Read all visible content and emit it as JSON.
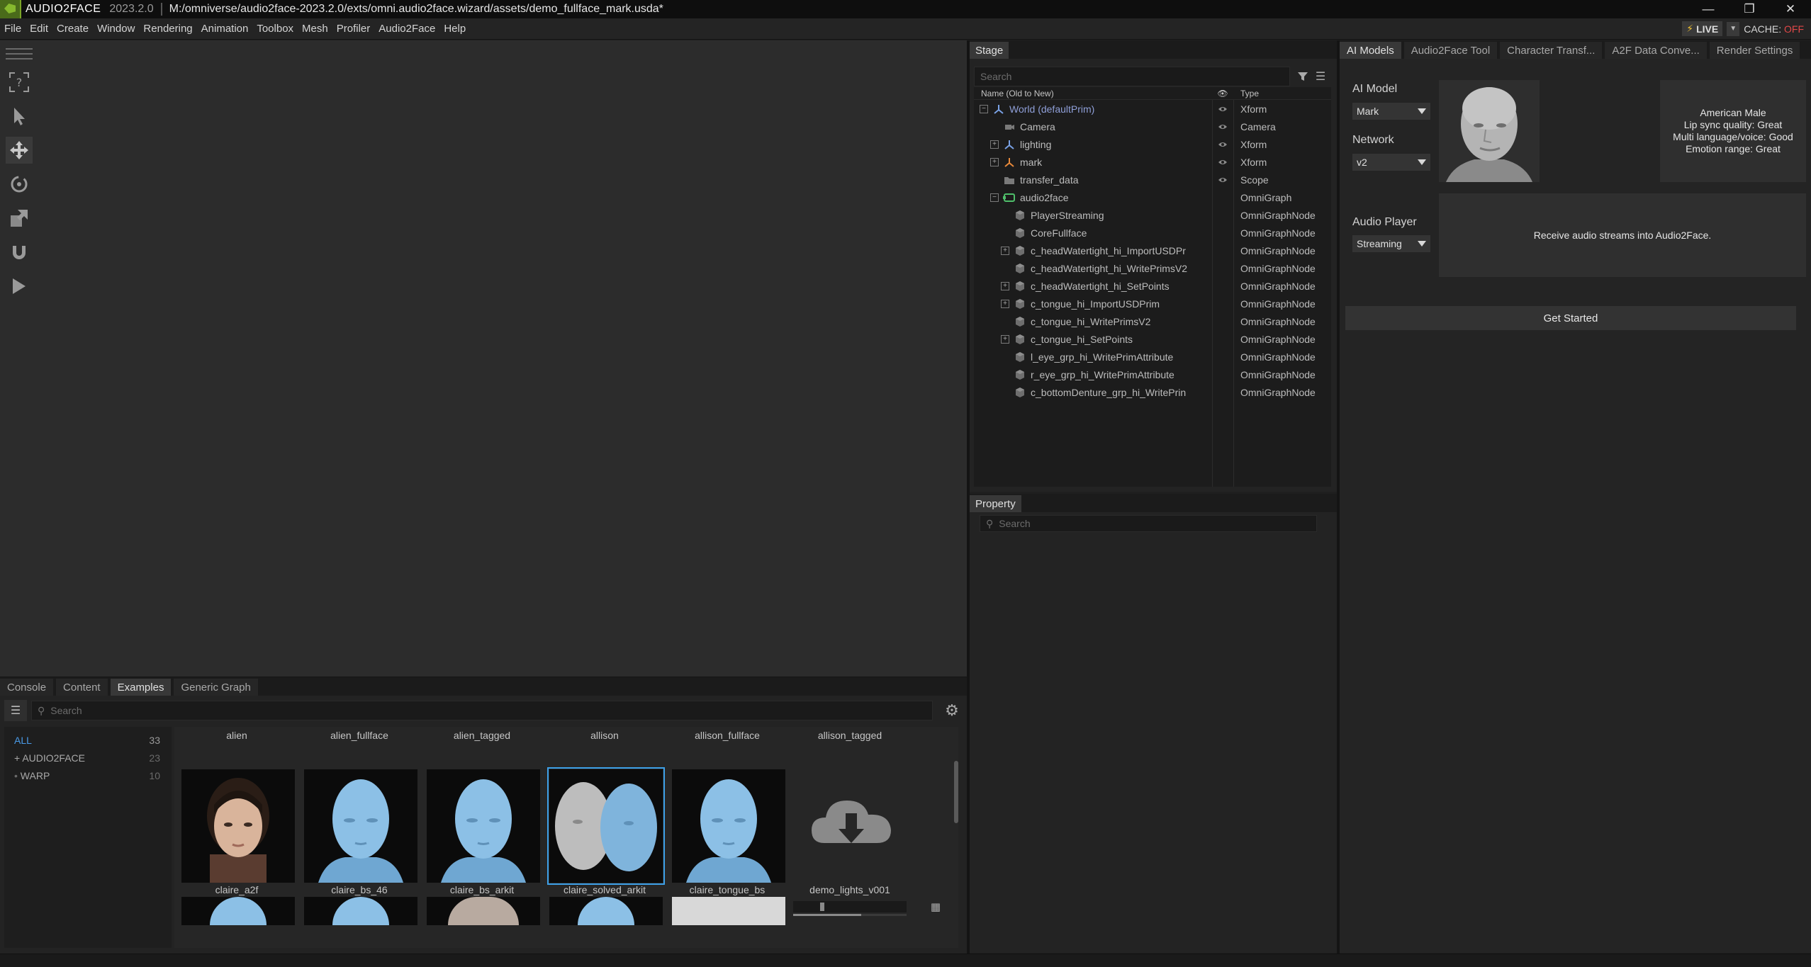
{
  "titlebar": {
    "app_name": "AUDIO2FACE",
    "version": "2023.2.0",
    "path": "M:/omniverse/audio2face-2023.2.0/exts/omni.audio2face.wizard/assets/demo_fullface_mark.usda*",
    "controls": [
      "minimize",
      "restore",
      "close"
    ]
  },
  "menubar": {
    "items": [
      "File",
      "Edit",
      "Create",
      "Window",
      "Rendering",
      "Animation",
      "Toolbox",
      "Mesh",
      "Profiler",
      "Audio2Face",
      "Help"
    ],
    "live_label": "LIVE",
    "cache_label": "CACHE:",
    "cache_state": "OFF"
  },
  "toolbar": {
    "tools": [
      "help-select-icon",
      "select-arrow-icon",
      "move-icon",
      "rotate-icon",
      "scale-icon",
      "snap-magnet-icon",
      "play-icon"
    ]
  },
  "bottom": {
    "tabs": [
      "Console",
      "Content",
      "Examples",
      "Generic Graph"
    ],
    "active_tab": "Examples",
    "search_placeholder": "Search",
    "tree": [
      {
        "label": "ALL",
        "count": "33"
      },
      {
        "label": "AUDIO2FACE",
        "count": "23",
        "prefix": "+"
      },
      {
        "label": "WARP",
        "count": "10",
        "prefix": "•"
      }
    ],
    "top_labels": [
      "alien",
      "alien_fullface",
      "alien_tagged",
      "allison",
      "allison_fullface",
      "allison_tagged"
    ],
    "items": [
      {
        "label": "claire_a2f"
      },
      {
        "label": "claire_bs_46"
      },
      {
        "label": "claire_bs_arkit"
      },
      {
        "label": "claire_solved_arkit"
      },
      {
        "label": "claire_tongue_bs"
      },
      {
        "label": "demo_lights_v001"
      }
    ]
  },
  "stage": {
    "tab": "Stage",
    "search_placeholder": "Search",
    "header_name": "Name (Old to New)",
    "header_type": "Type",
    "rows": [
      {
        "name": "World (defaultPrim)",
        "type": "Xform",
        "indent": 0,
        "exp": "-",
        "icon": "xform",
        "vis": true
      },
      {
        "name": "Camera",
        "type": "Camera",
        "indent": 1,
        "exp": "",
        "icon": "camera",
        "vis": true
      },
      {
        "name": "lighting",
        "type": "Xform",
        "indent": 1,
        "exp": "+",
        "icon": "xform",
        "vis": true
      },
      {
        "name": "mark",
        "type": "Xform",
        "indent": 1,
        "exp": "+",
        "icon": "xform-orange",
        "vis": true
      },
      {
        "name": "transfer_data",
        "type": "Scope",
        "indent": 1,
        "exp": "",
        "icon": "folder",
        "vis": true
      },
      {
        "name": "audio2face",
        "type": "OmniGraph",
        "indent": 1,
        "exp": "-",
        "icon": "graph",
        "vis": false
      },
      {
        "name": "PlayerStreaming",
        "type": "OmniGraphNode",
        "indent": 2,
        "exp": "",
        "icon": "cube",
        "vis": false
      },
      {
        "name": "CoreFullface",
        "type": "OmniGraphNode",
        "indent": 2,
        "exp": "",
        "icon": "cube",
        "vis": false
      },
      {
        "name": "c_headWatertight_hi_ImportUSDPr",
        "type": "OmniGraphNode",
        "indent": 2,
        "exp": "+",
        "icon": "cube",
        "vis": false
      },
      {
        "name": "c_headWatertight_hi_WritePrimsV2",
        "type": "OmniGraphNode",
        "indent": 2,
        "exp": "",
        "icon": "cube",
        "vis": false
      },
      {
        "name": "c_headWatertight_hi_SetPoints",
        "type": "OmniGraphNode",
        "indent": 2,
        "exp": "+",
        "icon": "cube",
        "vis": false
      },
      {
        "name": "c_tongue_hi_ImportUSDPrim",
        "type": "OmniGraphNode",
        "indent": 2,
        "exp": "+",
        "icon": "cube",
        "vis": false
      },
      {
        "name": "c_tongue_hi_WritePrimsV2",
        "type": "OmniGraphNode",
        "indent": 2,
        "exp": "",
        "icon": "cube",
        "vis": false
      },
      {
        "name": "c_tongue_hi_SetPoints",
        "type": "OmniGraphNode",
        "indent": 2,
        "exp": "+",
        "icon": "cube",
        "vis": false
      },
      {
        "name": "l_eye_grp_hi_WritePrimAttribute",
        "type": "OmniGraphNode",
        "indent": 2,
        "exp": "",
        "icon": "cube",
        "vis": false
      },
      {
        "name": "r_eye_grp_hi_WritePrimAttribute",
        "type": "OmniGraphNode",
        "indent": 2,
        "exp": "",
        "icon": "cube",
        "vis": false
      },
      {
        "name": "c_bottomDenture_grp_hi_WritePrin",
        "type": "OmniGraphNode",
        "indent": 2,
        "exp": "",
        "icon": "cube",
        "vis": false
      }
    ]
  },
  "property": {
    "tab": "Property",
    "search_placeholder": "Search"
  },
  "right": {
    "tabs": [
      "AI Models",
      "Audio2Face Tool",
      "Character Transf...",
      "A2F Data Conve...",
      "Render Settings"
    ],
    "active_tab": "AI Models",
    "ai_model_label": "AI Model",
    "ai_model_value": "Mark",
    "network_label": "Network",
    "network_value": "v2",
    "model_info": [
      "American Male",
      "Lip sync quality: Great",
      "Multi language/voice: Good",
      "Emotion range: Great"
    ],
    "audio_player_label": "Audio Player",
    "audio_player_value": "Streaming",
    "audio_info": "Receive audio streams into Audio2Face.",
    "get_started": "Get Started"
  },
  "colors": {
    "accent_blue": "#3da0e8",
    "live_bolt": "#f2c230",
    "cache_off": "#e04848",
    "world_text": "#8f9fd8"
  }
}
